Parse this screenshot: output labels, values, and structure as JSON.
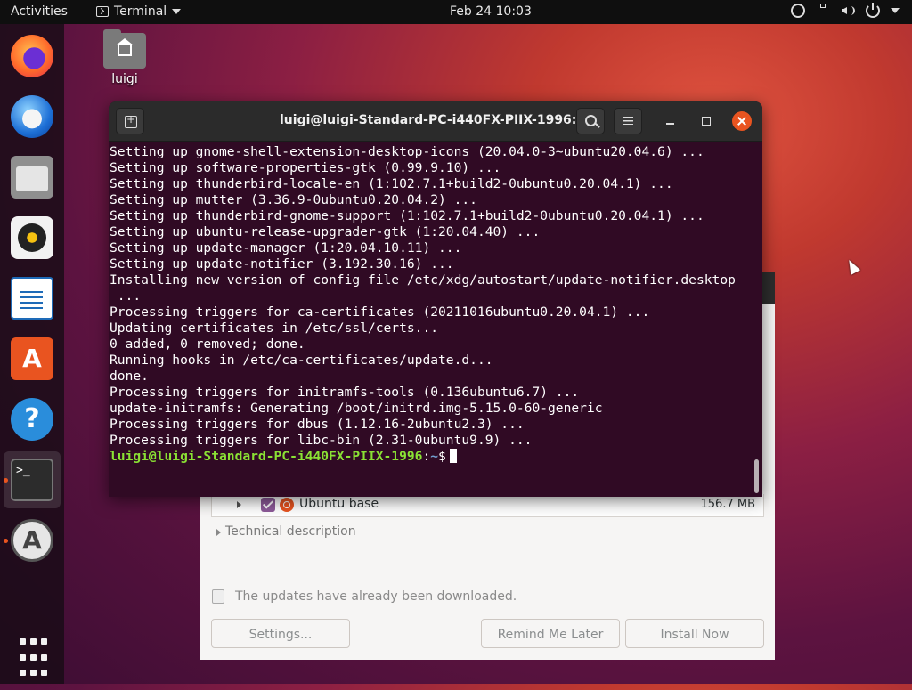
{
  "topbar": {
    "activities": "Activities",
    "app_name": "Terminal",
    "clock": "Feb 24  10:03",
    "tray_icons": [
      "accessibility-icon",
      "network-icon",
      "volume-icon",
      "power-icon"
    ]
  },
  "dock": {
    "items": [
      "Firefox",
      "Thunderbird",
      "Files",
      "Rhythmbox",
      "LibreOffice Writer",
      "Ubuntu Software",
      "Help",
      "Terminal",
      "Software Updater",
      "Show Applications"
    ],
    "store_glyph": "A",
    "help_glyph": "?",
    "terminal_glyph": ">_",
    "updater_glyph": "A"
  },
  "desktop": {
    "home_label": "luigi"
  },
  "terminal": {
    "title": "luigi@luigi-Standard-PC-i440FX-PIIX-1996: ~",
    "lines": [
      "Setting up gnome-shell-extension-desktop-icons (20.04.0-3~ubuntu20.04.6) ...",
      "Setting up software-properties-gtk (0.99.9.10) ...",
      "Setting up thunderbird-locale-en (1:102.7.1+build2-0ubuntu0.20.04.1) ...",
      "Setting up mutter (3.36.9-0ubuntu0.20.04.2) ...",
      "Setting up thunderbird-gnome-support (1:102.7.1+build2-0ubuntu0.20.04.1) ...",
      "Setting up ubuntu-release-upgrader-gtk (1:20.04.40) ...",
      "Setting up update-manager (1:20.04.10.11) ...",
      "Setting up update-notifier (3.192.30.16) ...",
      "Installing new version of config file /etc/xdg/autostart/update-notifier.desktop",
      " ...",
      "Processing triggers for ca-certificates (20211016ubuntu0.20.04.1) ...",
      "Updating certificates in /etc/ssl/certs...",
      "0 added, 0 removed; done.",
      "Running hooks in /etc/ca-certificates/update.d...",
      "done.",
      "Processing triggers for initramfs-tools (0.136ubuntu6.7) ...",
      "update-initramfs: Generating /boot/initrd.img-5.15.0-60-generic",
      "Processing triggers for dbus (1.12.16-2ubuntu2.3) ...",
      "Processing triggers for libc-bin (2.31-0ubuntu9.9) ..."
    ],
    "prompt_user": "luigi@luigi-Standard-PC-i440FX-PIIX-1996",
    "prompt_sep": ":",
    "prompt_path": "~",
    "prompt_symbol": "$"
  },
  "updater": {
    "package_name": "Ubuntu base",
    "package_size": "156.7 MB",
    "technical_description": "Technical description",
    "notice": "The updates have already been downloaded.",
    "settings_button": "Settings...",
    "remind_button": "Remind Me Later",
    "install_button": "Install Now"
  },
  "colors": {
    "accent": "#e95420",
    "terminal_bg": "#300a24",
    "prompt_user": "#8ae234",
    "prompt_path": "#729fcf"
  }
}
